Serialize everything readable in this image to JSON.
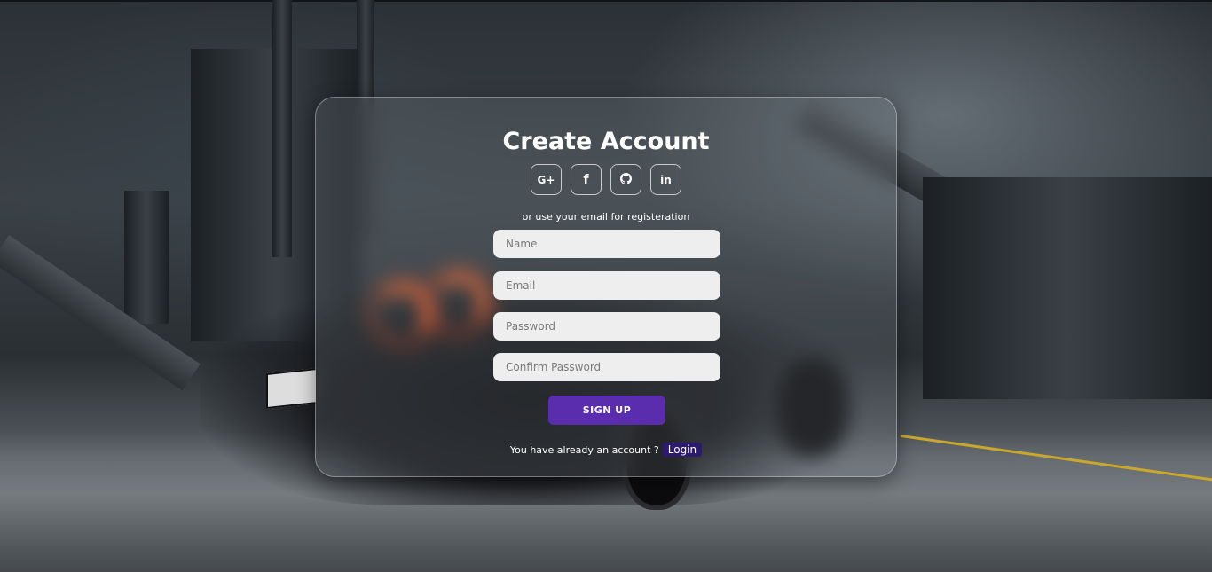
{
  "card": {
    "title": "Create Account",
    "social_buttons": [
      {
        "label": "G+",
        "icon": "google-plus-icon"
      },
      {
        "label": "f",
        "icon": "facebook-icon"
      },
      {
        "label": "",
        "icon": "github-icon"
      },
      {
        "label": "in",
        "icon": "linkedin-icon"
      }
    ],
    "subtitle": "or use your email for registeration",
    "fields": {
      "name_placeholder": "Name",
      "email_placeholder": "Email",
      "password_placeholder": "Password",
      "confirm_password_placeholder": "Confirm Password"
    },
    "signup_label": "SIGN UP",
    "footer_text": "You have already an account ?",
    "login_label": "Login"
  },
  "colors": {
    "accent": "#5a2cae",
    "login_bg": "#2d1a6e",
    "input_bg": "#eeeeee"
  }
}
